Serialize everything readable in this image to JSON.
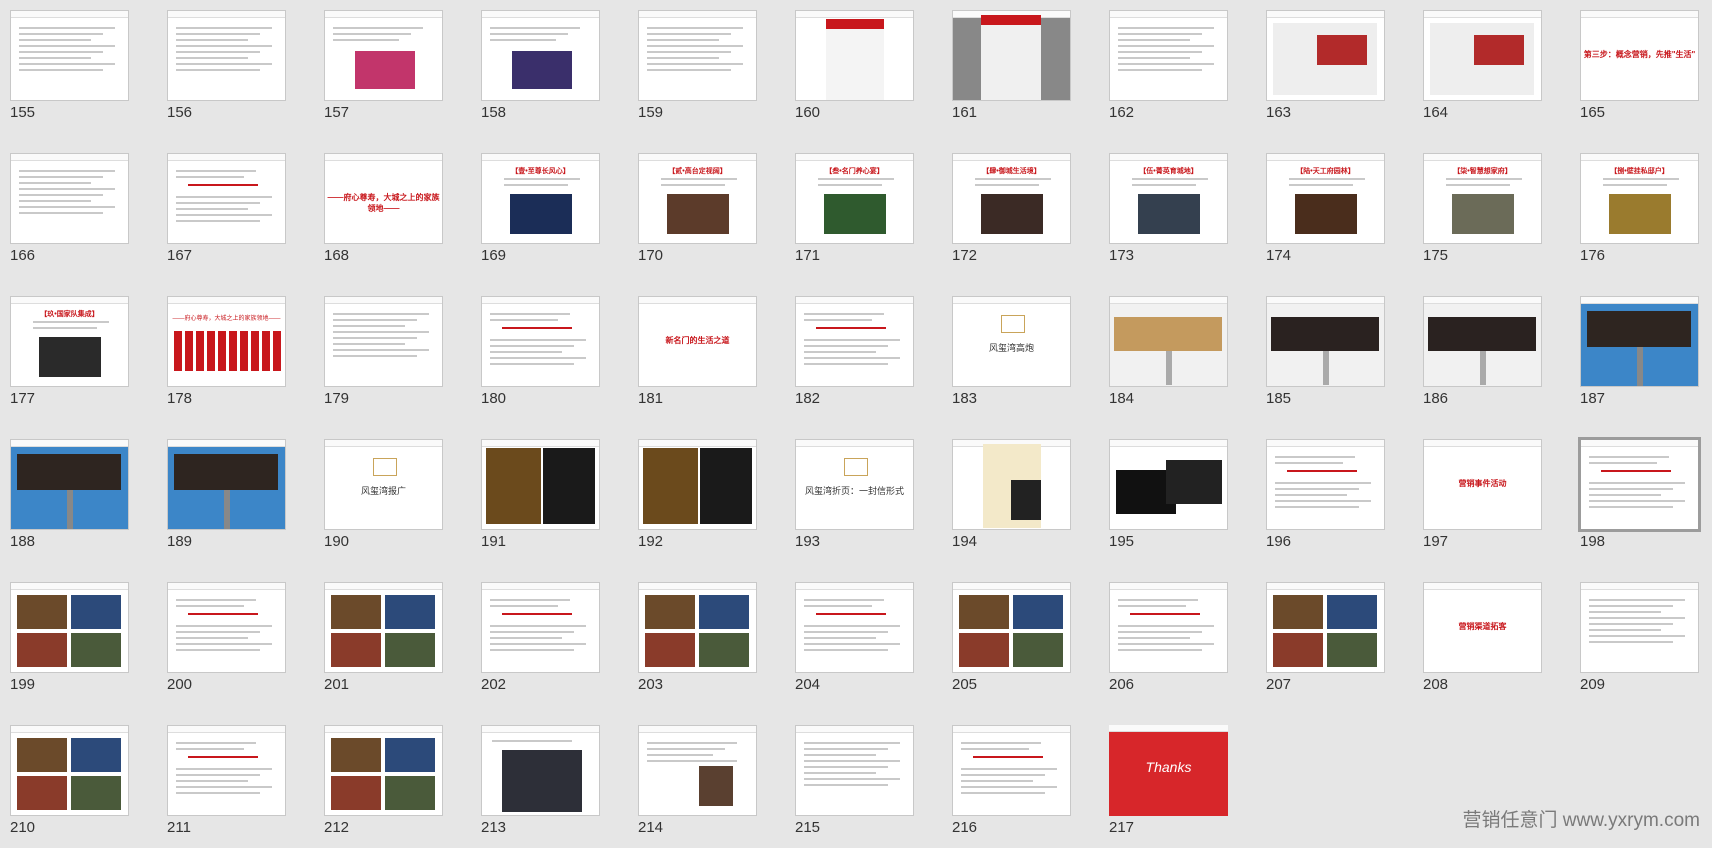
{
  "slides": [
    {
      "n": "155",
      "k": "text"
    },
    {
      "n": "156",
      "k": "text"
    },
    {
      "n": "157",
      "k": "photo",
      "c": "#c2356b"
    },
    {
      "n": "158",
      "k": "photo",
      "c": "#3a2f6b"
    },
    {
      "n": "159",
      "k": "text"
    },
    {
      "n": "160",
      "k": "news"
    },
    {
      "n": "161",
      "k": "news-hand"
    },
    {
      "n": "162",
      "k": "text"
    },
    {
      "n": "163",
      "k": "web"
    },
    {
      "n": "164",
      "k": "web"
    },
    {
      "n": "165",
      "k": "title",
      "t": "第三步：概念营销，先推\"生活\""
    },
    {
      "n": "166",
      "k": "text"
    },
    {
      "n": "167",
      "k": "text-red"
    },
    {
      "n": "168",
      "k": "title",
      "t": "——府心尊寿，大城之上的家族领地——"
    },
    {
      "n": "169",
      "k": "card",
      "t": "【壹•至尊长风心】",
      "c": "#1b2d57"
    },
    {
      "n": "170",
      "k": "card",
      "t": "【贰•高台定视阔】",
      "c": "#5c3b2a"
    },
    {
      "n": "171",
      "k": "card",
      "t": "【叁•名门养心宴】",
      "c": "#2f5a2e"
    },
    {
      "n": "172",
      "k": "card",
      "t": "【肆•御城生活境】",
      "c": "#3b2a25"
    },
    {
      "n": "173",
      "k": "card",
      "t": "【伍•菁英育城地】",
      "c": "#34404f"
    },
    {
      "n": "174",
      "k": "card",
      "t": "【陆•天工府园林】",
      "c": "#4a2d1c"
    },
    {
      "n": "175",
      "k": "card",
      "t": "【柒•智慧想家府】",
      "c": "#6b6b58"
    },
    {
      "n": "176",
      "k": "card",
      "t": "【捌•壁挂私邸户】",
      "c": "#9a7b2e"
    },
    {
      "n": "177",
      "k": "card",
      "t": "【玖•国家队集成】",
      "c": "#2a2a2a"
    },
    {
      "n": "178",
      "k": "banners",
      "t": "——府心尊寿，大城之上的家族领地——"
    },
    {
      "n": "179",
      "k": "text"
    },
    {
      "n": "180",
      "k": "text-red"
    },
    {
      "n": "181",
      "k": "title",
      "t": "新名门的生活之道"
    },
    {
      "n": "182",
      "k": "text-red"
    },
    {
      "n": "183",
      "k": "logo",
      "t": "风玺湾高炮"
    },
    {
      "n": "184",
      "k": "board"
    },
    {
      "n": "185",
      "k": "board-dark"
    },
    {
      "n": "186",
      "k": "board-dark"
    },
    {
      "n": "187",
      "k": "billboard"
    },
    {
      "n": "188",
      "k": "billboard"
    },
    {
      "n": "189",
      "k": "billboard"
    },
    {
      "n": "190",
      "k": "logo",
      "t": "风玺湾报广"
    },
    {
      "n": "191",
      "k": "gold"
    },
    {
      "n": "192",
      "k": "gold"
    },
    {
      "n": "193",
      "k": "logo",
      "t": "风玺湾折页：一封信形式"
    },
    {
      "n": "194",
      "k": "folder"
    },
    {
      "n": "195",
      "k": "cards"
    },
    {
      "n": "196",
      "k": "text-red"
    },
    {
      "n": "197",
      "k": "title",
      "t": "营销事件活动"
    },
    {
      "n": "198",
      "k": "text-red",
      "sel": true
    },
    {
      "n": "199",
      "k": "collage"
    },
    {
      "n": "200",
      "k": "text-red"
    },
    {
      "n": "201",
      "k": "collage"
    },
    {
      "n": "202",
      "k": "text-red"
    },
    {
      "n": "203",
      "k": "collage"
    },
    {
      "n": "204",
      "k": "text-red"
    },
    {
      "n": "205",
      "k": "collage"
    },
    {
      "n": "206",
      "k": "text-red"
    },
    {
      "n": "207",
      "k": "collage"
    },
    {
      "n": "208",
      "k": "title",
      "t": "营销渠道拓客"
    },
    {
      "n": "209",
      "k": "text"
    },
    {
      "n": "210",
      "k": "collage"
    },
    {
      "n": "211",
      "k": "text-red"
    },
    {
      "n": "212",
      "k": "collage"
    },
    {
      "n": "213",
      "k": "dark-poster"
    },
    {
      "n": "214",
      "k": "text-photo"
    },
    {
      "n": "215",
      "k": "text"
    },
    {
      "n": "216",
      "k": "text-red"
    },
    {
      "n": "217",
      "k": "thanks",
      "t": "Thanks"
    }
  ],
  "watermark": "营销任意门 www.yxrym.com",
  "colors": {
    "accent": "#c8171c",
    "thanks_bg": "#d7262a",
    "background": "#e6e6e6"
  }
}
